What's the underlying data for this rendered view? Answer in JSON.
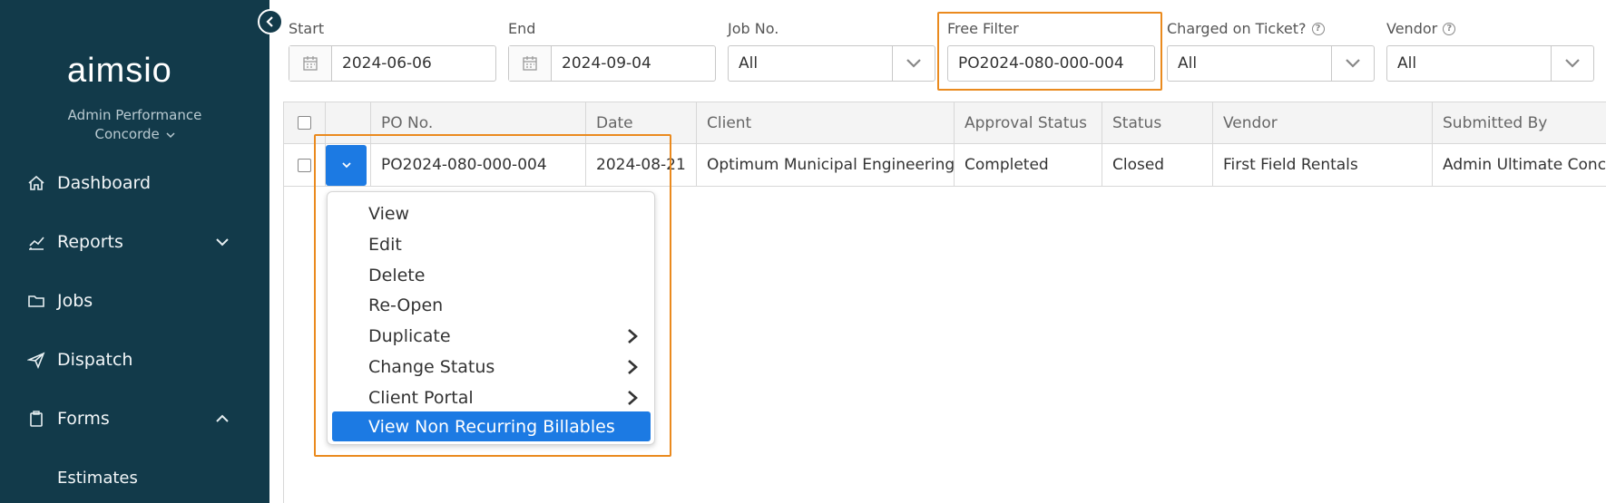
{
  "sidebar": {
    "brand": "aimsio",
    "org_name": "Admin Performance",
    "org_sub": "Concorde",
    "items": [
      {
        "label": "Dashboard",
        "icon": "home-icon"
      },
      {
        "label": "Reports",
        "icon": "chart-icon"
      },
      {
        "label": "Jobs",
        "icon": "folder-icon"
      },
      {
        "label": "Dispatch",
        "icon": "paper-plane-icon"
      },
      {
        "label": "Forms",
        "icon": "clipboard-icon"
      },
      {
        "label": "Estimates",
        "icon": ""
      }
    ]
  },
  "filters": {
    "start_label": "Start",
    "start_value": "2024-06-06",
    "end_label": "End",
    "end_value": "2024-09-04",
    "job_label": "Job No.",
    "job_value": "All",
    "free_label": "Free Filter",
    "free_value": "PO2024-080-000-004",
    "charged_label": "Charged on Ticket?",
    "charged_value": "All",
    "vendor_label": "Vendor",
    "vendor_value": "All"
  },
  "table": {
    "columns": [
      "PO No.",
      "Date",
      "Client",
      "Approval Status",
      "Status",
      "Vendor",
      "Submitted By"
    ],
    "rows": [
      [
        "PO2024-080-000-004",
        "2024-08-21",
        "Optimum Municipal Engineering",
        "Completed",
        "Closed",
        "First Field Rentals",
        "Admin Ultimate Concorde"
      ]
    ]
  },
  "menu": {
    "items": [
      "View",
      "Edit",
      "Delete",
      "Re-Open",
      "Duplicate",
      "Change Status",
      "Client Portal",
      "View Non Recurring Billables"
    ]
  },
  "colors": {
    "sidebar_bg": "#123a4a",
    "accent": "#1c7ae3",
    "highlight": "#ea8a1e"
  }
}
